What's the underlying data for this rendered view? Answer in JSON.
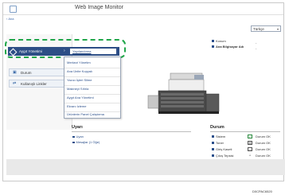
{
  "app": {
    "title": "Web Image Monitor"
  },
  "breadcrumb": {
    "home": "Ana"
  },
  "language": {
    "selected": "Türkçe"
  },
  "nav": {
    "device_management": "Aygıt Yönetimi",
    "selected_submenu": "Yapılandırma",
    "status": "Durum",
    "quick_links": "Kullanışlı Linkler"
  },
  "submenu": {
    "items": [
      "Merkezi Yönetim",
      "Ana Ünite Kopyalı",
      "Yazıcı İşleri Silme",
      "Makineyi Sıfırla",
      "Aygıt Ana Yönetimi",
      "Ekranı İzleme",
      "Ürünlerin Panel Çalıştırma"
    ]
  },
  "info": {
    "items": [
      {
        "label": "Konum",
        "value": "-"
      },
      {
        "label": "Ana Bilgisayar Adı",
        "value": "-"
      }
    ]
  },
  "alerts": {
    "title": "Uyarı",
    "items": [
      "Uyarı",
      "Mesajlar (1 Öğe)"
    ]
  },
  "status_section": {
    "title": "Durum",
    "items": [
      {
        "label": "Sistem",
        "value": "Durum OK"
      },
      {
        "label": "Toner",
        "value": "Durum OK"
      },
      {
        "label": "Giriş Kaseti",
        "value": "Durum OK"
      },
      {
        "label": "Çıkış Tepsisi",
        "value": "Durum OK"
      }
    ]
  },
  "figure_code": "D0CPAC6520",
  "colors": {
    "nav_selected": "#2d4e86",
    "highlight": "#20a64a",
    "link": "#2b4f8b"
  }
}
